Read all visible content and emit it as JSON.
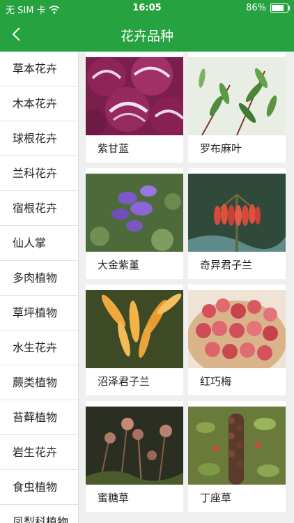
{
  "status": {
    "carrier": "无 SIM 卡",
    "time": "16:05",
    "battery": "86%",
    "battery_level": 0.86
  },
  "nav": {
    "title": "花卉品种"
  },
  "sidebar": {
    "items": [
      {
        "label": "草本花卉"
      },
      {
        "label": "木本花卉"
      },
      {
        "label": "球根花卉"
      },
      {
        "label": "兰科花卉"
      },
      {
        "label": "宿根花卉"
      },
      {
        "label": "仙人掌"
      },
      {
        "label": "多肉植物"
      },
      {
        "label": "草坪植物"
      },
      {
        "label": "水生花卉"
      },
      {
        "label": "蕨类植物"
      },
      {
        "label": "苔藓植物"
      },
      {
        "label": "岩生花卉"
      },
      {
        "label": "食虫植物"
      },
      {
        "label": "凤梨科植物"
      }
    ]
  },
  "grid": {
    "items": [
      {
        "label": "紫甘蓝",
        "image": "purple-cabbage-photo"
      },
      {
        "label": "罗布麻叶",
        "image": "dogbane-leaf-photo"
      },
      {
        "label": "大金紫堇",
        "image": "corydalis-photo"
      },
      {
        "label": "奇异君子兰",
        "image": "clivia-photo"
      },
      {
        "label": "沼泽君子兰",
        "image": "swamp-clivia-photo"
      },
      {
        "label": "红巧梅",
        "image": "red-strawflower-photo"
      },
      {
        "label": "蜜糖草",
        "image": "molasses-grass-photo"
      },
      {
        "label": "丁座草",
        "image": "boschniakia-photo"
      }
    ]
  },
  "colors": {
    "primary": "#27a240"
  }
}
